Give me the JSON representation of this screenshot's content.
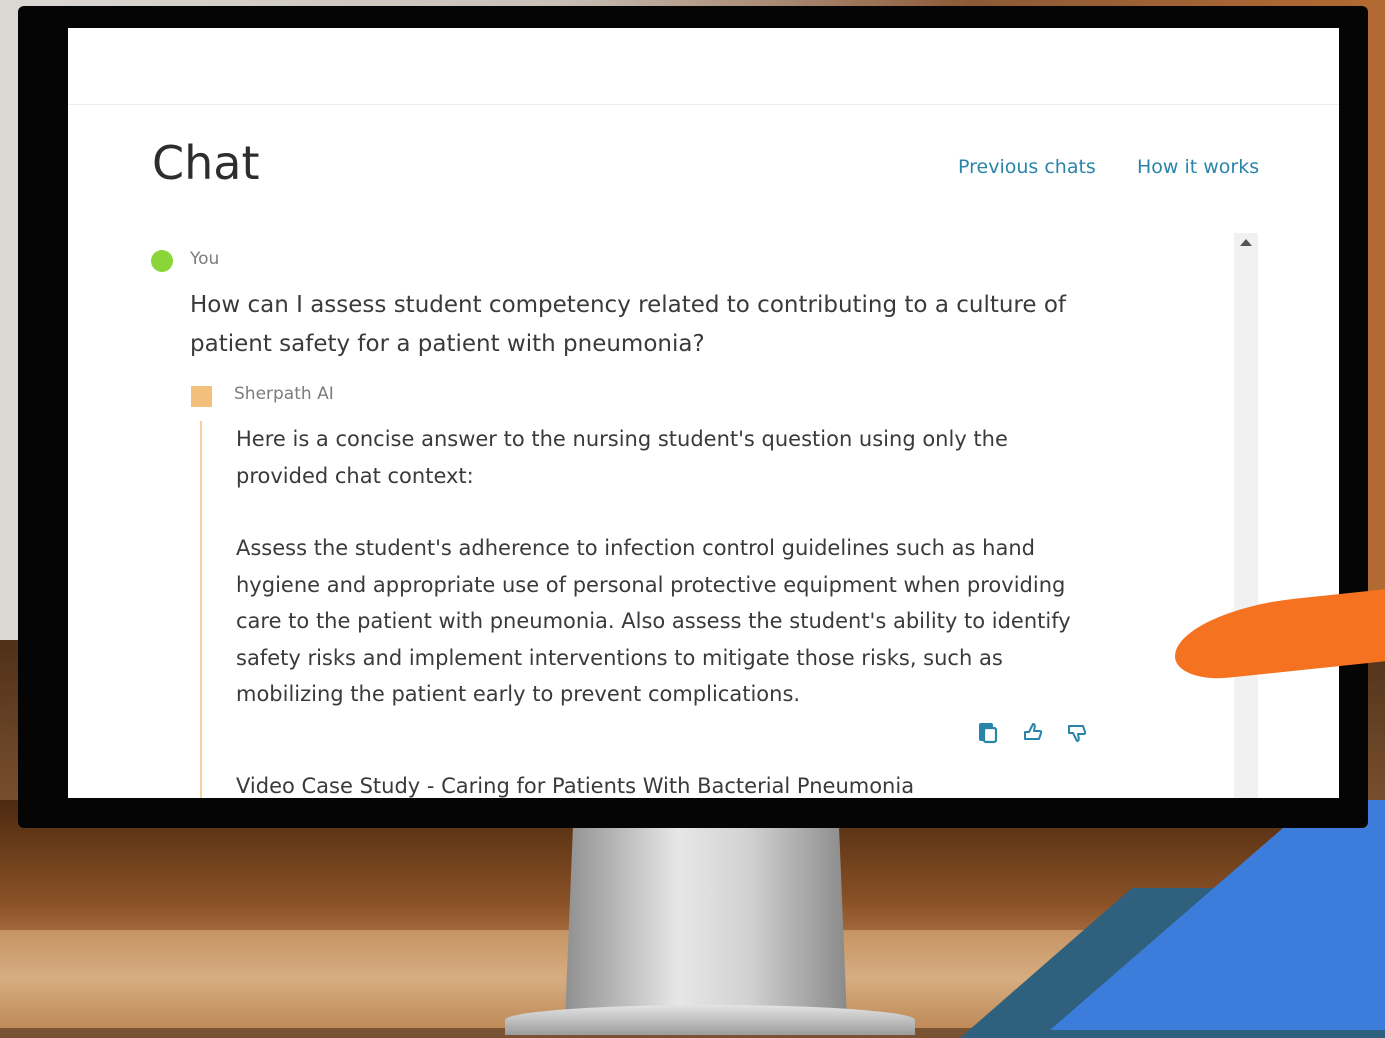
{
  "page": {
    "title": "Chat"
  },
  "header": {
    "links": {
      "previous_chats": "Previous chats",
      "how_it_works": "How it works"
    }
  },
  "conversation": {
    "user": {
      "name": "You",
      "message": "How can I assess student competency related to contributing to a culture of patient safety for a patient with pneumonia?"
    },
    "assistant": {
      "name": "Sherpath AI",
      "intro": "Here is a concise answer to the nursing student's question using only the provided chat context:",
      "body": "Assess the student's adherence to infection control guidelines such as hand hygiene and appropriate use of personal protective equipment when providing care to the patient with pneumonia. Also assess the student's ability to identify safety risks and implement interventions to mitigate those risks, such as mobilizing the patient early to prevent complications.",
      "source": "Video Case Study - Caring for Patients With Bacterial Pneumonia",
      "actions": [
        "copy-icon",
        "thumbs-up-icon",
        "thumbs-down-icon"
      ]
    }
  },
  "colors": {
    "link": "#2a84a8",
    "user_dot": "#8ad538",
    "assistant_marker": "#f3c07c",
    "assistant_bar": "#f5cf9e",
    "accent_orange": "#f57221",
    "accent_blue": "#3c7ddb"
  }
}
